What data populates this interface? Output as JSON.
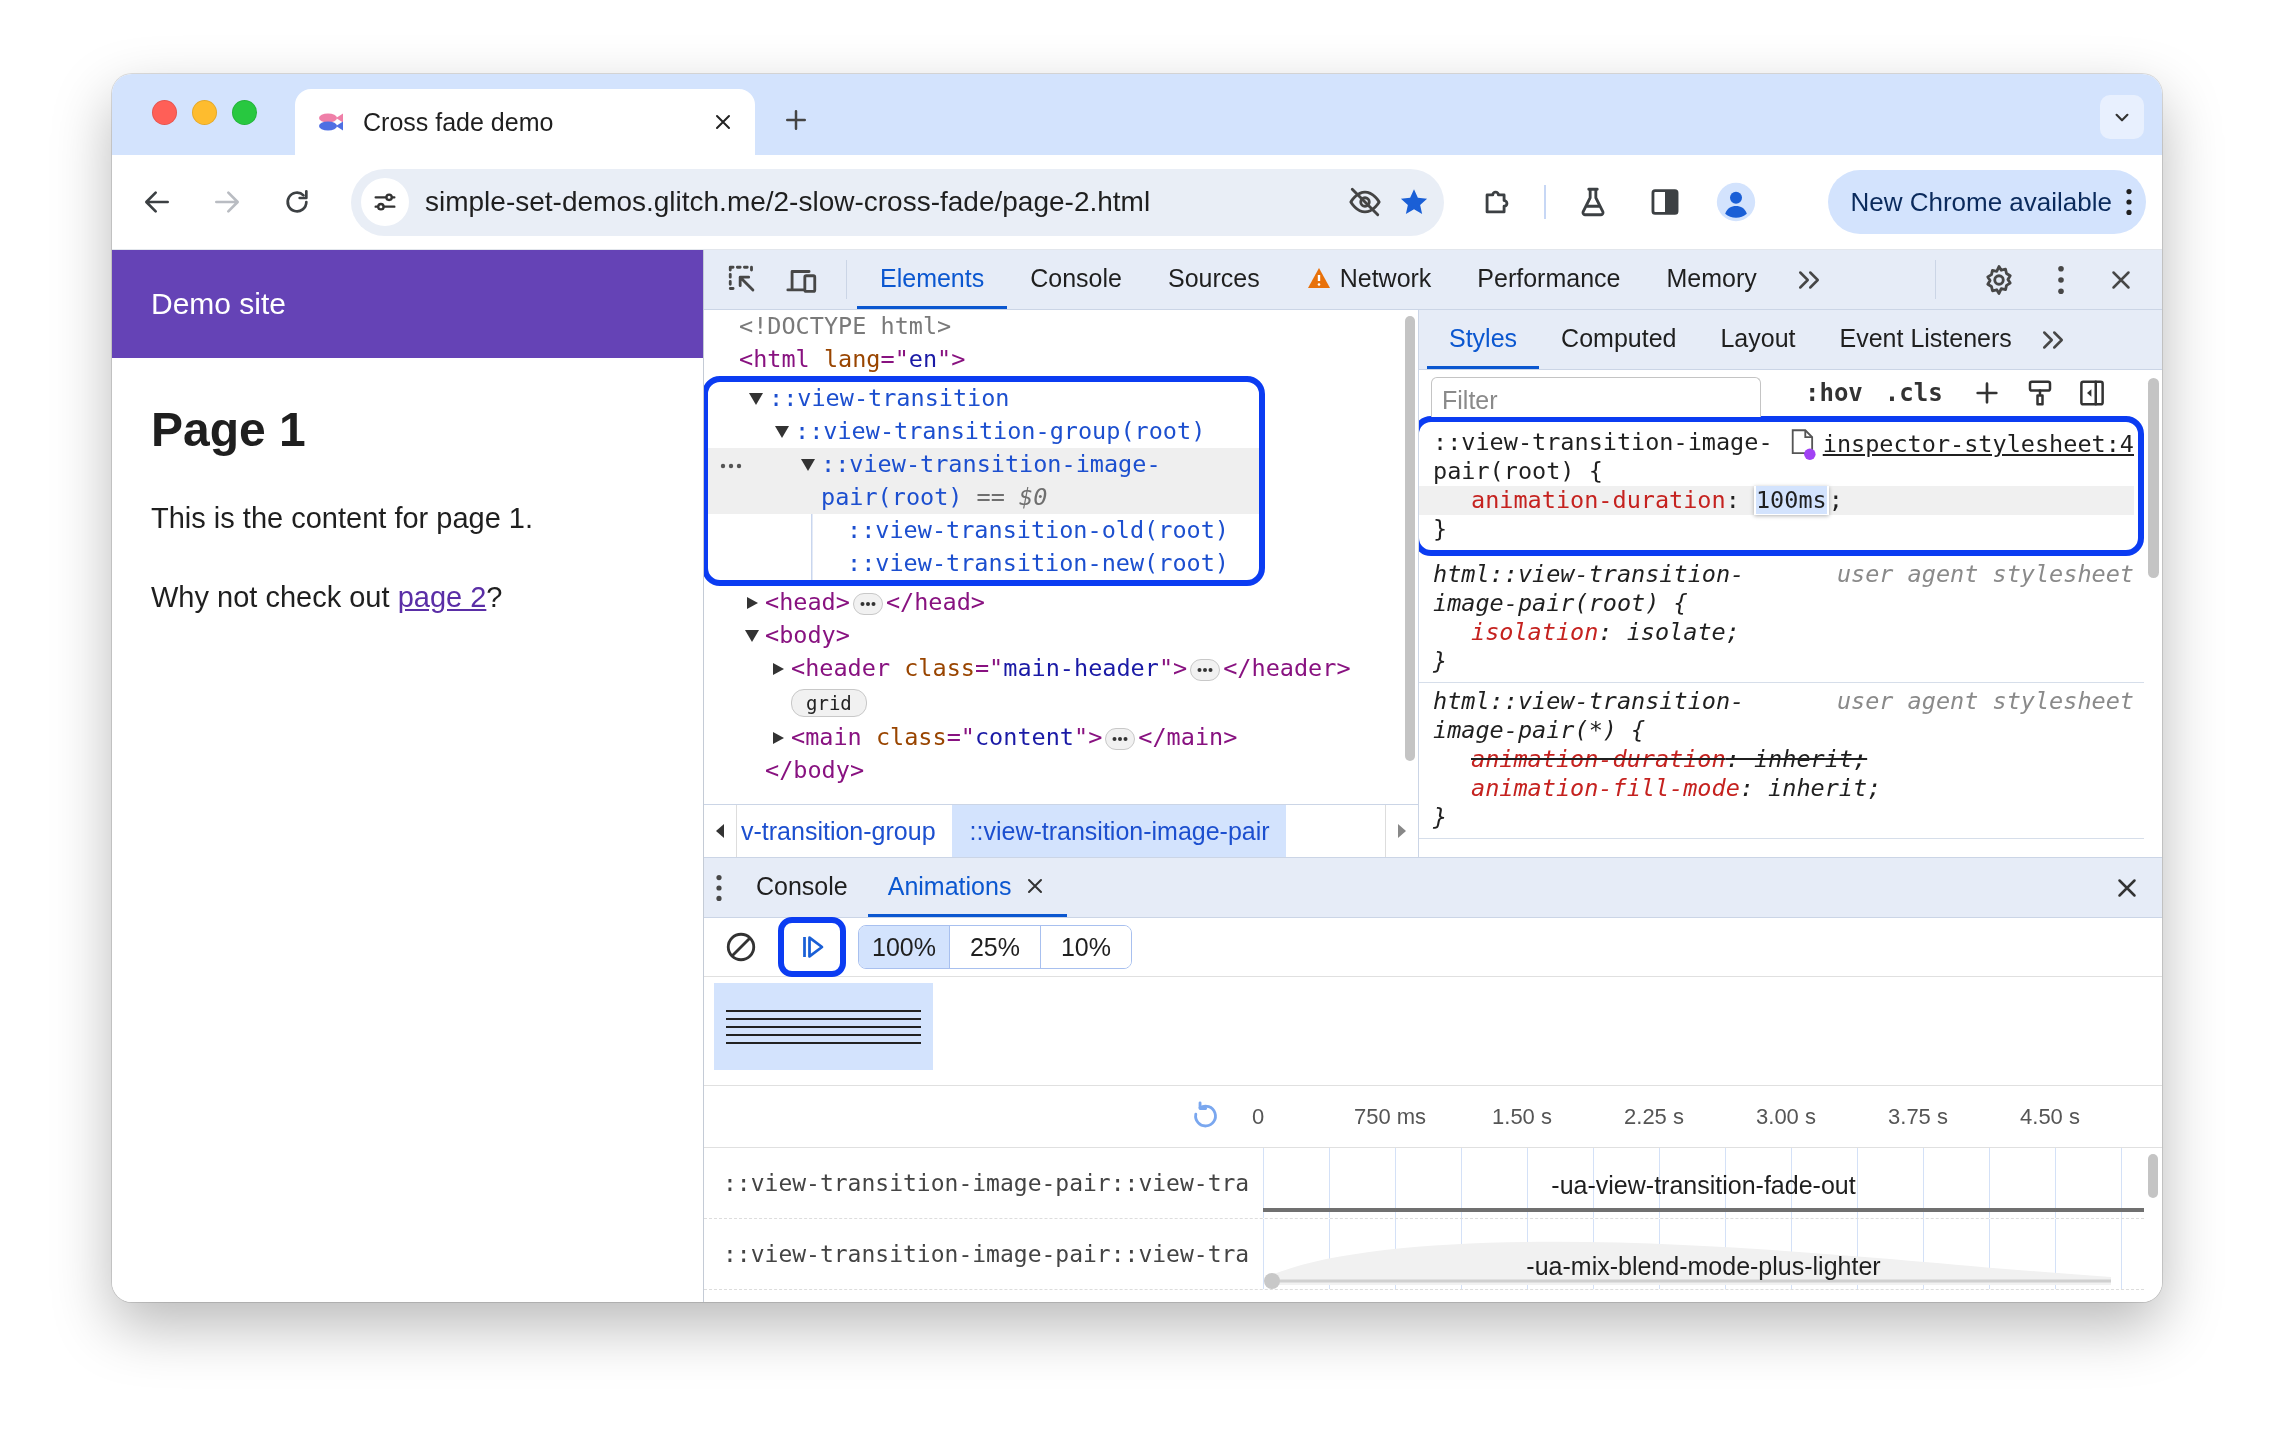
{
  "browser": {
    "tab": {
      "title": "Cross fade demo"
    },
    "nav": [
      {
        "kind": "back",
        "disabled": false
      },
      {
        "kind": "forward",
        "disabled": true
      },
      {
        "kind": "reload",
        "disabled": false
      }
    ],
    "url": "simple-set-demos.glitch.me/2-slow-cross-fade/page-2.html",
    "bookmarked": true,
    "update_button": "New Chrome available"
  },
  "page": {
    "site_title": "Demo site",
    "heading": "Page 1",
    "paragraph": "This is the content for page 1.",
    "prompt": {
      "before": "Why not check out ",
      "link": "page 2",
      "after": "?"
    }
  },
  "devtools": {
    "tabs": [
      {
        "label": "Elements",
        "selected": true,
        "warning": false
      },
      {
        "label": "Console",
        "selected": false,
        "warning": false
      },
      {
        "label": "Sources",
        "selected": false,
        "warning": false
      },
      {
        "label": "Network",
        "selected": false,
        "warning": true
      },
      {
        "label": "Performance",
        "selected": false,
        "warning": false
      },
      {
        "label": "Memory",
        "selected": false,
        "warning": false
      }
    ],
    "dom": [
      {
        "kind": "doctype",
        "text": "<!DOCTYPE html>",
        "selected": false
      },
      {
        "kind": "element",
        "open": "<html lang=\"en\">",
        "selected": false,
        "children": [
          {
            "kind": "pseudo",
            "text": "::view-transition",
            "expanded": true,
            "selected": false,
            "highlighted": true,
            "children": [
              {
                "kind": "pseudo",
                "text": "::view-transition-group(root)",
                "expanded": true,
                "selected": false,
                "children": [
                  {
                    "kind": "pseudo",
                    "text": "::view-transition-image-pair(root)",
                    "suffix": "== $0",
                    "expanded": true,
                    "selected": true,
                    "children": [
                      {
                        "kind": "pseudo",
                        "text": "::view-transition-old(root)",
                        "selected": false
                      },
                      {
                        "kind": "pseudo",
                        "text": "::view-transition-new(root)",
                        "selected": false
                      }
                    ]
                  }
                ]
              }
            ]
          },
          {
            "kind": "element",
            "open": "<head>",
            "close": "</head>",
            "expanded": false,
            "selected": false
          },
          {
            "kind": "element",
            "open": "<body>",
            "close": "</body>",
            "expanded": true,
            "selected": false,
            "children": [
              {
                "kind": "element",
                "open": "<header class=\"main-header\">",
                "close": "</header>",
                "expanded": false,
                "selected": false,
                "badge": "grid"
              },
              {
                "kind": "element",
                "open": "<main class=\"content\">",
                "close": "</main>",
                "expanded": false,
                "selected": false
              }
            ]
          }
        ]
      }
    ],
    "breadcrumbs": [
      {
        "label": "v-transition-group",
        "selected": false
      },
      {
        "label": "::view-transition-image-pair",
        "selected": true
      }
    ],
    "styles": {
      "tabs": [
        {
          "label": "Styles",
          "selected": true
        },
        {
          "label": "Computed",
          "selected": false
        },
        {
          "label": "Layout",
          "selected": false
        },
        {
          "label": "Event Listeners",
          "selected": false
        }
      ],
      "filter_placeholder": "Filter",
      "toggles": [
        ":hov",
        ".cls"
      ],
      "rules": [
        {
          "selector": "::view-transition-image-pair(root) {",
          "source": "inspector-stylesheet:4",
          "kind": "link",
          "highlighted": true,
          "declarations": [
            {
              "text": "animation-duration: 100ms;",
              "editing": true,
              "overridden": false
            }
          ],
          "close": "}"
        },
        {
          "selector": "html::view-transition-image-pair(root) {",
          "source": "user agent stylesheet",
          "kind": "builtin",
          "highlighted": false,
          "declarations": [
            {
              "text": "isolation: isolate;",
              "editing": false,
              "overridden": false
            }
          ],
          "close": "}"
        },
        {
          "selector": "html::view-transition-image-pair(*) {",
          "source": "user agent stylesheet",
          "kind": "builtin",
          "highlighted": false,
          "declarations": [
            {
              "text": "animation-duration: inherit;",
              "editing": false,
              "overridden": true
            },
            {
              "text": "animation-fill-mode: inherit;",
              "editing": false,
              "overridden": false
            }
          ],
          "close": "}"
        }
      ]
    }
  },
  "drawer": {
    "tabs": [
      {
        "label": "Console",
        "selected": false,
        "closable": false
      },
      {
        "label": "Animations",
        "selected": true,
        "closable": true
      }
    ],
    "replay_highlighted": true,
    "speeds": [
      {
        "label": "100%",
        "selected": true
      },
      {
        "label": "25%",
        "selected": false
      },
      {
        "label": "10%",
        "selected": false
      }
    ],
    "preview_groups": [
      {
        "selected": true
      }
    ],
    "ticks": [
      "0",
      "750 ms",
      "1.50 s",
      "2.25 s",
      "3.00 s",
      "3.75 s",
      "4.50 s"
    ],
    "animations": [
      {
        "target": "::view-transition-image-pair::view-tra",
        "name": "-ua-view-transition-fade-out",
        "kind": "flat"
      },
      {
        "target": "::view-transition-image-pair::view-tra",
        "name": "-ua-mix-blend-mode-plus-lighter",
        "kind": "eased"
      }
    ]
  }
}
